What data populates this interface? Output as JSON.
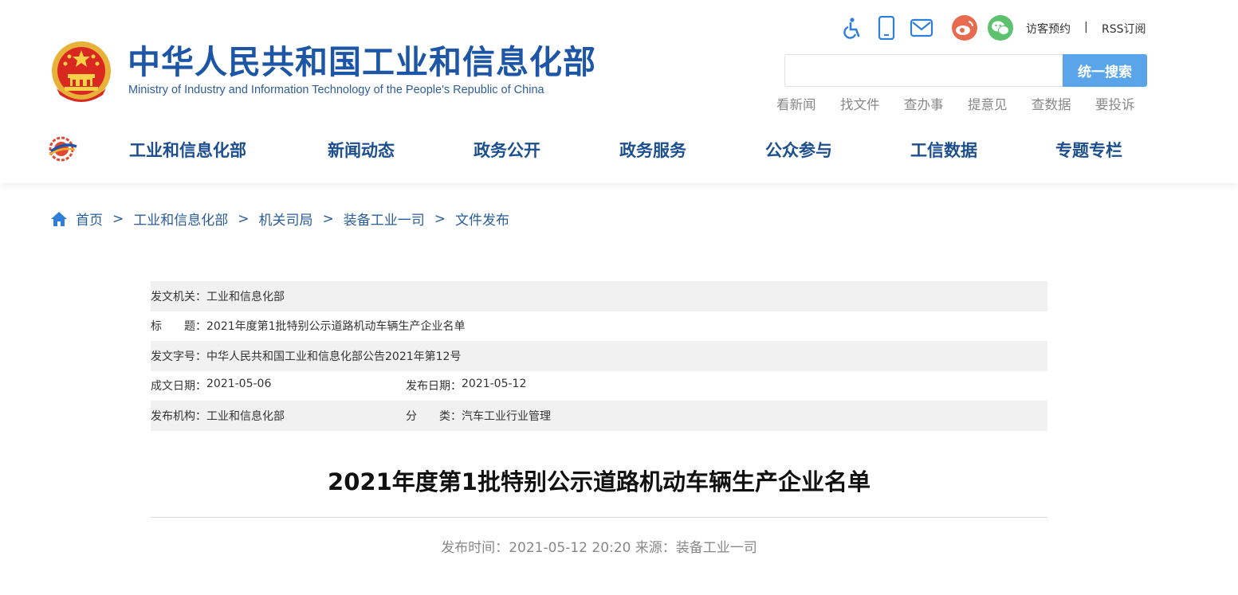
{
  "header": {
    "title": "中华人民共和国工业和信息化部",
    "subtitle": "Ministry of Industry and Information Technology of the People's Republic of China",
    "utilities": {
      "icons": [
        "accessibility-icon",
        "mobile-icon",
        "mail-icon",
        "weibo-icon",
        "wechat-icon"
      ],
      "visitor_booking": "访客预约",
      "separator": "|",
      "rss": "RSS订阅"
    },
    "search": {
      "placeholder": "",
      "button": "统一搜索"
    },
    "quick_links": [
      "看新闻",
      "找文件",
      "查办事",
      "提意见",
      "查数据",
      "要投诉"
    ],
    "nav": [
      "工业和信息化部",
      "新闻动态",
      "政务公开",
      "政务服务",
      "公众参与",
      "工信数据",
      "专题专栏"
    ],
    "colors": {
      "brand_blue": "#1d56a6",
      "search_button": "#5aa5ea",
      "nav_text": "#1d4f8f"
    }
  },
  "breadcrumb": {
    "items": [
      "首页",
      "工业和信息化部",
      "机关司局",
      "装备工业一司",
      "文件发布"
    ],
    "separator": ">"
  },
  "meta": {
    "issuer_label": "发文机关：",
    "issuer": "工业和信息化部",
    "title_label": "标　　题：",
    "title": "2021年度第1批特别公示道路机动车辆生产企业名单",
    "doc_no_label": "发文字号：",
    "doc_no": "中华人民共和国工业和信息化部公告2021年第12号",
    "written_date_label": "成文日期：",
    "written_date": "2021-05-06",
    "publish_date_label": "发布日期：",
    "publish_date": "2021-05-12",
    "publisher_label": "发布机构：",
    "publisher": "工业和信息化部",
    "category_label": "分　　类：",
    "category": "汽车工业行业管理"
  },
  "article": {
    "title": "2021年度第1批特别公示道路机动车辆生产企业名单",
    "time_label": "发布时间：",
    "time": "2021-05-12 20:20",
    "source_label": "来源：",
    "source": "装备工业一司"
  }
}
